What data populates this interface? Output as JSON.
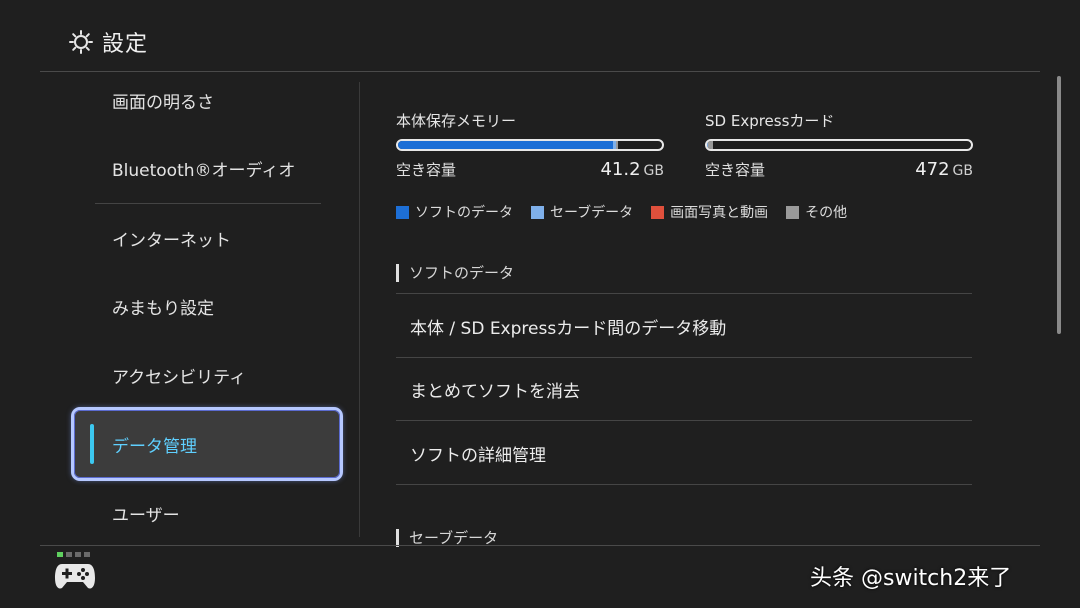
{
  "header": {
    "title": "設定",
    "icon": "gear-icon"
  },
  "sidebar": {
    "items": [
      {
        "label": "画面の明るさ"
      },
      {
        "label": "Bluetooth®オーディオ"
      },
      {
        "label": "インターネット"
      },
      {
        "label": "みまもり設定"
      },
      {
        "label": "アクセシビリティ"
      },
      {
        "label": "データ管理"
      },
      {
        "label": "ユーザー"
      }
    ],
    "active_index": 5
  },
  "storage": {
    "internal": {
      "name": "本体保存メモリー",
      "free_label": "空き容量",
      "free_value": "41.2",
      "unit": "GB",
      "used_soft_fraction": 0.815,
      "used_save_fraction": 0.012,
      "used_other_fraction": 0.008
    },
    "sd": {
      "name": "SD Expressカード",
      "free_label": "空き容量",
      "free_value": "472",
      "unit": "GB",
      "used_soft_fraction": 0.0,
      "used_save_fraction": 0.004,
      "used_other_fraction": 0.018
    }
  },
  "legend": [
    {
      "label": "ソフトのデータ",
      "color": "#1d6fd6"
    },
    {
      "label": "セーブデータ",
      "color": "#7fb0ea"
    },
    {
      "label": "画面写真と動画",
      "color": "#e0503c"
    },
    {
      "label": "その他",
      "color": "#9a9a9a"
    }
  ],
  "sections": {
    "soft_title": "ソフトのデータ",
    "soft_items": [
      {
        "label": "本体 / SD Expressカード間のデータ移動"
      },
      {
        "label": "まとめてソフトを消去"
      },
      {
        "label": "ソフトの詳細管理"
      }
    ],
    "save_title": "セーブデータ"
  },
  "footer": {
    "watermark": "头条 @switch2来了"
  }
}
